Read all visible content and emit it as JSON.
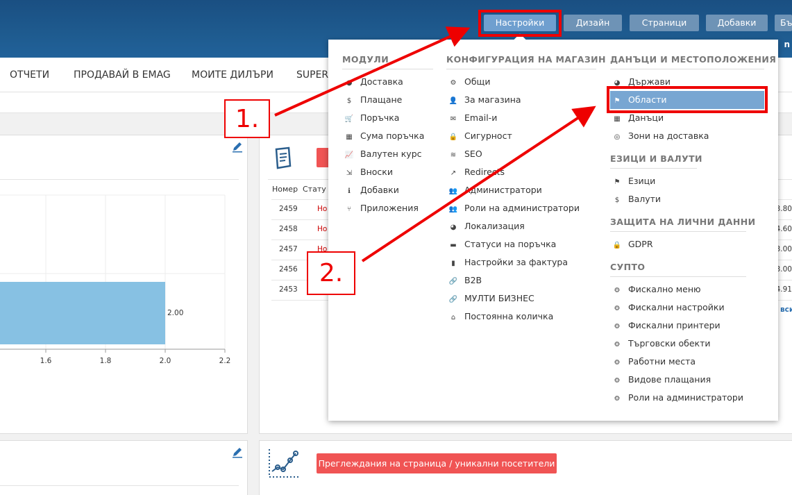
{
  "top_nav": [
    {
      "label": "Настройки",
      "active": true
    },
    {
      "label": "Дизайн"
    },
    {
      "label": "Страници"
    },
    {
      "label": "Добавки"
    },
    {
      "label": "Бъ"
    }
  ],
  "header_user": "n",
  "main_nav": [
    "ОТЧЕТИ",
    "ПРОДАВАЙ В EMAG",
    "МОИТЕ ДИЛЪРИ",
    "SUPER"
  ],
  "chart_data": {
    "type": "bar",
    "orientation": "horizontal",
    "values": [
      2.0
    ],
    "data_labels": [
      "2.00"
    ],
    "x_ticks": [
      "1.6",
      "1.8",
      "2.0",
      "2.2"
    ],
    "xlim": [
      1.6,
      2.2
    ],
    "bar_color": "#87c1e3"
  },
  "orders": {
    "headers": [
      "Номер",
      "Стату"
    ],
    "rows": [
      {
        "num": "2459",
        "status": "Но",
        "amount": "3.80"
      },
      {
        "num": "2458",
        "status": "Но",
        "amount": "4.60"
      },
      {
        "num": "2457",
        "status": "Но",
        "amount": "3.00"
      },
      {
        "num": "2456",
        "status": "",
        "amount": "3.00"
      },
      {
        "num": "2453",
        "status": "",
        "amount": "4.91"
      }
    ],
    "view_all": "вси"
  },
  "stats_button": "Преглеждания на страница / уникални посетители",
  "dropdown": {
    "modules": {
      "title": "МОДУЛИ",
      "items": [
        {
          "icon": "globe-icon",
          "glyph": "◕",
          "label": "Доставка"
        },
        {
          "icon": "dollar-icon",
          "glyph": "$",
          "label": "Плащане"
        },
        {
          "icon": "cart-icon",
          "glyph": "🛒",
          "label": "Поръчка"
        },
        {
          "icon": "calculator-icon",
          "glyph": "▦",
          "label": "Сума поръчка"
        },
        {
          "icon": "line-chart-icon",
          "glyph": "📈",
          "label": "Валутен курс"
        },
        {
          "icon": "import-icon",
          "glyph": "⇲",
          "label": "Вноски"
        },
        {
          "icon": "info-icon",
          "glyph": "ℹ",
          "label": "Добавки"
        },
        {
          "icon": "fork-icon",
          "glyph": "⑂",
          "label": "Приложения"
        }
      ]
    },
    "store_config": {
      "title": "КОНФИГУРАЦИЯ НА МАГАЗИН",
      "items": [
        {
          "icon": "gear-icon",
          "glyph": "⚙",
          "label": "Общи"
        },
        {
          "icon": "user-icon",
          "glyph": "👤",
          "label": "За магазина"
        },
        {
          "icon": "inbox-icon",
          "glyph": "✉",
          "label": "Email-и"
        },
        {
          "icon": "lock-icon",
          "glyph": "🔒",
          "label": "Сигурност"
        },
        {
          "icon": "seo-icon",
          "glyph": "≋",
          "label": "SEO"
        },
        {
          "icon": "external-link-icon",
          "glyph": "↗",
          "label": "Redirects"
        },
        {
          "icon": "users-icon",
          "glyph": "👥",
          "label": "Администратори"
        },
        {
          "icon": "users-icon",
          "glyph": "👥",
          "label": "Роли на администратори"
        },
        {
          "icon": "globe-icon",
          "glyph": "◕",
          "label": "Локализация"
        },
        {
          "icon": "briefcase-icon",
          "glyph": "▬",
          "label": "Статуси на поръчка"
        },
        {
          "icon": "file-icon",
          "glyph": "▮",
          "label": "Настройки за фактура"
        },
        {
          "icon": "link-icon",
          "glyph": "🔗",
          "label": "B2B"
        },
        {
          "icon": "link-icon",
          "glyph": "🔗",
          "label": "МУЛТИ БИЗНЕС"
        },
        {
          "icon": "bank-icon",
          "glyph": "⌂",
          "label": "Постоянна количка"
        }
      ]
    },
    "taxes": {
      "title": "ДАНЪЦИ И МЕСТОПОЛОЖЕНИЯ",
      "items": [
        {
          "icon": "globe-icon",
          "glyph": "◕",
          "label": "Държави"
        },
        {
          "icon": "flag-icon",
          "glyph": "⚑",
          "label": "Области",
          "active": true
        },
        {
          "icon": "calculator-icon",
          "glyph": "▦",
          "label": "Данъци"
        },
        {
          "icon": "compass-icon",
          "glyph": "◎",
          "label": "Зони на доставка"
        }
      ]
    },
    "languages": {
      "title": "ЕЗИЦИ И ВАЛУТИ",
      "items": [
        {
          "icon": "flag-icon",
          "glyph": "⚑",
          "label": "Езици"
        },
        {
          "icon": "dollar-icon",
          "glyph": "$",
          "label": "Валути"
        }
      ]
    },
    "privacy": {
      "title": "ЗАЩИТА НА ЛИЧНИ ДАННИ",
      "items": [
        {
          "icon": "lock-icon",
          "glyph": "🔒",
          "label": "GDPR"
        }
      ]
    },
    "supto": {
      "title": "СУПТО",
      "items": [
        {
          "icon": "gear-icon",
          "glyph": "⚙",
          "label": "Фискално меню"
        },
        {
          "icon": "gear-icon",
          "glyph": "⚙",
          "label": "Фискални настройки"
        },
        {
          "icon": "gear-icon",
          "glyph": "⚙",
          "label": "Фискални принтери"
        },
        {
          "icon": "gear-icon",
          "glyph": "⚙",
          "label": "Търговски обекти"
        },
        {
          "icon": "gear-icon",
          "glyph": "⚙",
          "label": "Работни места"
        },
        {
          "icon": "gear-icon",
          "glyph": "⚙",
          "label": "Видове плащания"
        },
        {
          "icon": "gear-icon",
          "glyph": "⚙",
          "label": "Роли на администратори"
        }
      ]
    }
  },
  "annotations": {
    "step1": "1.",
    "step2": "2."
  }
}
